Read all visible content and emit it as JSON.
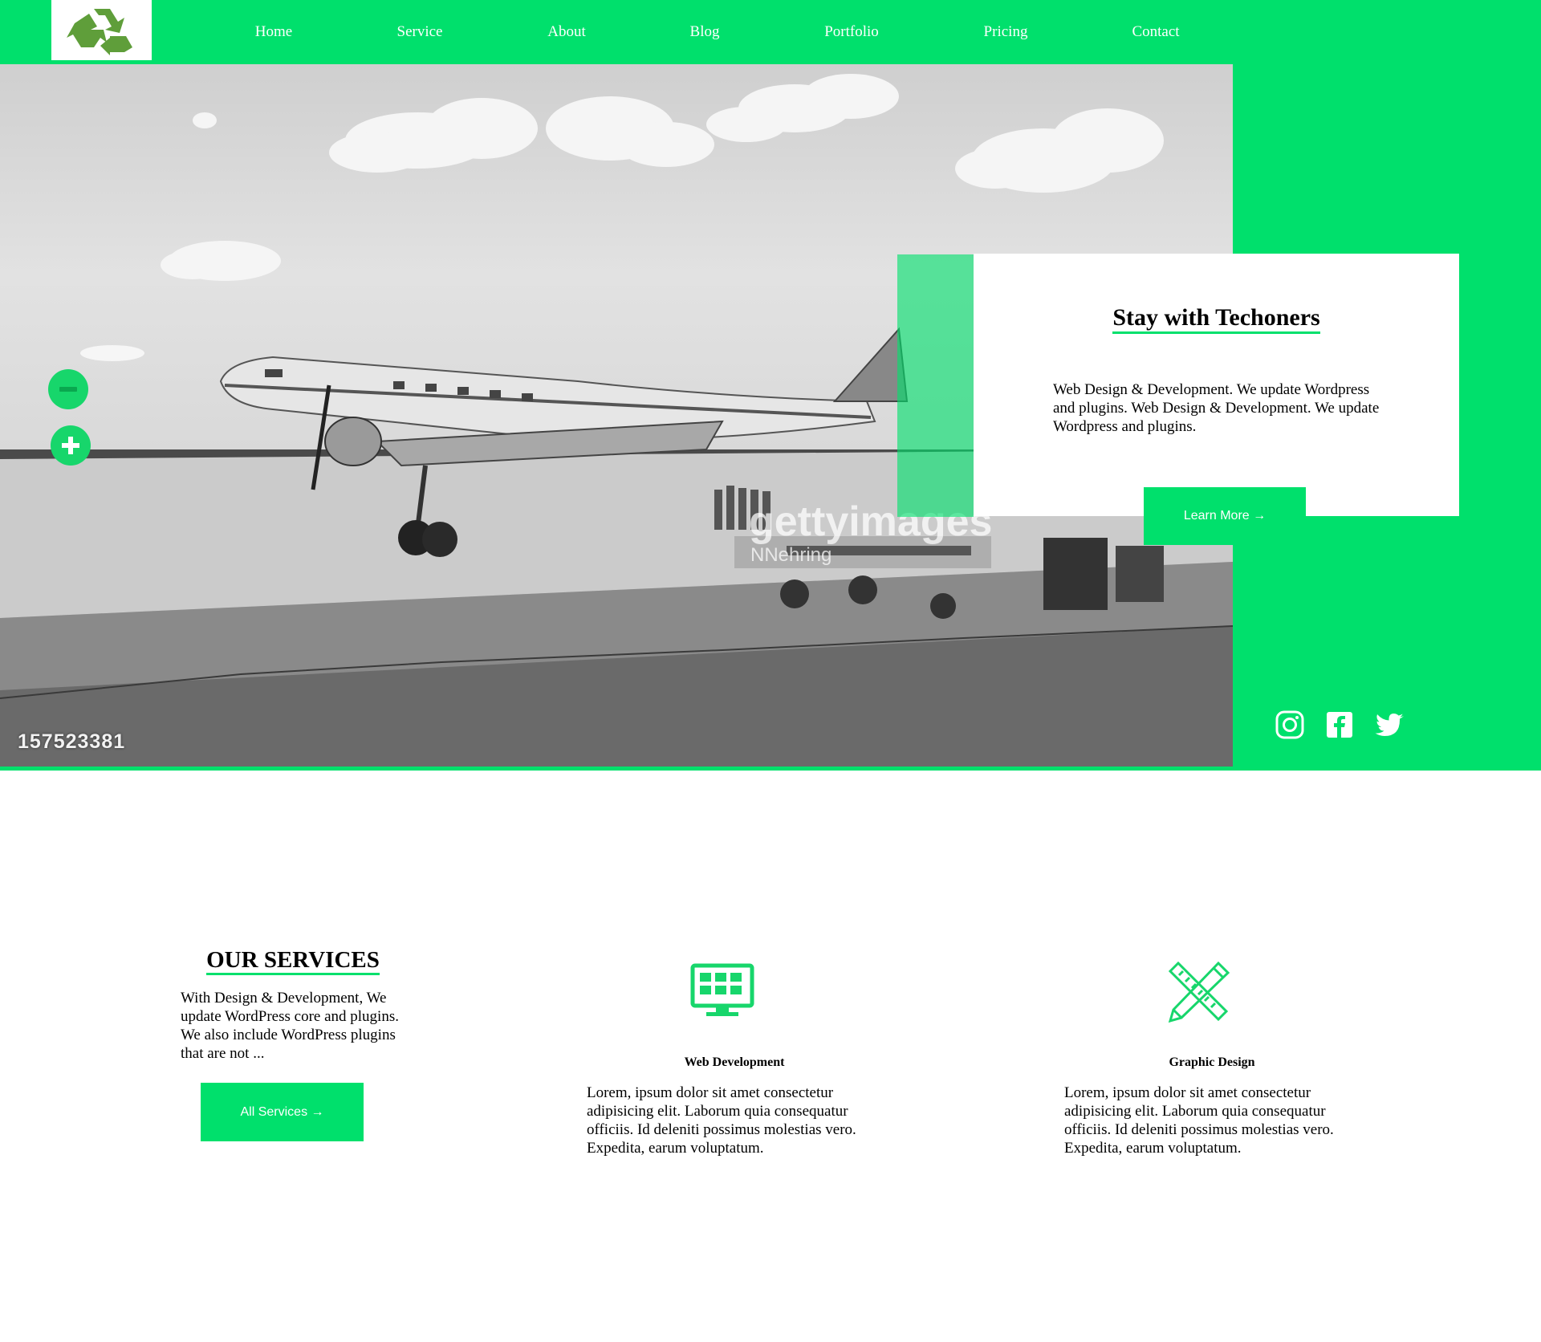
{
  "header": {
    "logo": {
      "icon": "recycle-icon",
      "color": "#5f9e3a"
    },
    "nav": [
      "Home",
      "Service",
      "About",
      "Blog",
      "Portfolio",
      "Pricing",
      "Contact"
    ]
  },
  "hero": {
    "image": {
      "photo_id": "157523381",
      "watermark": "gettyimages",
      "credit": "NNehring"
    },
    "zoom_out_icon": "minus-circle-icon",
    "zoom_in_icon": "plus-circle-icon",
    "card": {
      "title": "Stay with Techoners",
      "text": "Web Design & Development. We update Wordpress and plugins. Web Design & Development. We update Wordpress and plugins.",
      "button": "Learn More →"
    },
    "social": [
      "instagram-icon",
      "facebook-icon",
      "twitter-icon"
    ]
  },
  "services": {
    "title": "OUR SERVICES",
    "description": "With Design & Development, We update WordPress core and plugins. We also include WordPress plugins that are not ...",
    "button": "All Services →",
    "items": [
      {
        "icon": "monitor-grid-icon",
        "name": "Web Development",
        "text": "Lorem, ipsum dolor sit amet consectetur adipisicing elit. Laborum quia consequatur officiis. Id deleniti possimus molestias vero. Expedita, earum voluptatum."
      },
      {
        "icon": "pencil-ruler-icon",
        "name": "Graphic Design",
        "text": "Lorem, ipsum dolor sit amet consectetur adipisicing elit. Laborum quia consequatur officiis. Id deleniti possimus molestias vero. Expedita, earum voluptatum."
      }
    ]
  },
  "colors": {
    "accent": "#00e06c",
    "text": "#000000",
    "background": "#ffffff"
  }
}
